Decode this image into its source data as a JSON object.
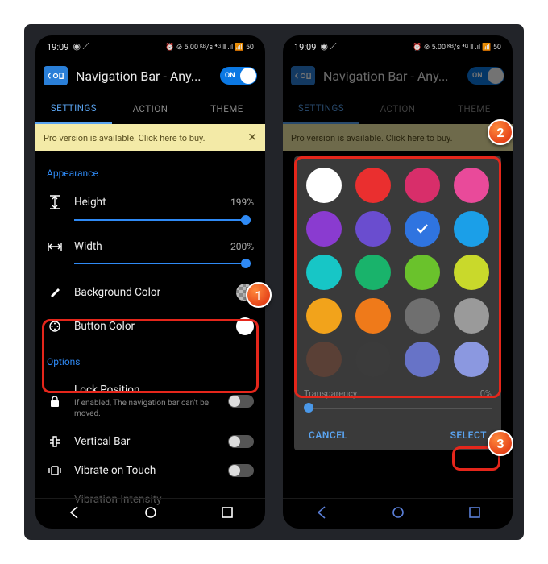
{
  "status": {
    "time": "19:09",
    "icons_left": "◉ ⟋",
    "icons_right": "⏰ ⊘ 5.00 ᴷᴮ/s ⁴ᴳ ⫴ .ıl 📶 50"
  },
  "header": {
    "title": "Navigation Bar - Any...",
    "toggle_on": "ON"
  },
  "tabs": {
    "settings": "SETTINGS",
    "action": "ACTION",
    "theme": "THEME"
  },
  "promo": {
    "text": "Pro version is available. Click here to buy.",
    "close": "✕"
  },
  "sections": {
    "appearance": "Appearance",
    "options": "Options"
  },
  "appearance": {
    "height_label": "Height",
    "height_value": "199%",
    "width_label": "Width",
    "width_value": "200%",
    "bgcolor_label": "Background Color",
    "btncolor_label": "Button Color"
  },
  "options": {
    "lock_label": "Lock Position",
    "lock_sub": "If enabled, The navigation bar can't be moved.",
    "vertical_label": "Vertical Bar",
    "vibrate_label": "Vibrate on Touch",
    "vibintensity_label": "Vibration Intensity"
  },
  "dialog": {
    "transparency_label": "Transparency",
    "transparency_value": "0%",
    "cancel": "CANCEL",
    "select": "SELECT"
  },
  "callouts": {
    "one": "1",
    "two": "2",
    "three": "3"
  },
  "colors": [
    "#ffffff",
    "#ea2f2f",
    "#d82e6a",
    "#e94a9a",
    "#8a3bd0",
    "#6a4dcf",
    "#2f74e0",
    "#1b9fe8",
    "#17c6c6",
    "#19b36b",
    "#6ac22c",
    "#c9d92b",
    "#f2a31b",
    "#ef7a1a",
    "#6f6f6f",
    "#9a9a9a",
    "#5a4036",
    "#3b3b3b",
    "#6773c7",
    "#8b98e0"
  ],
  "selected_color_index": 6
}
